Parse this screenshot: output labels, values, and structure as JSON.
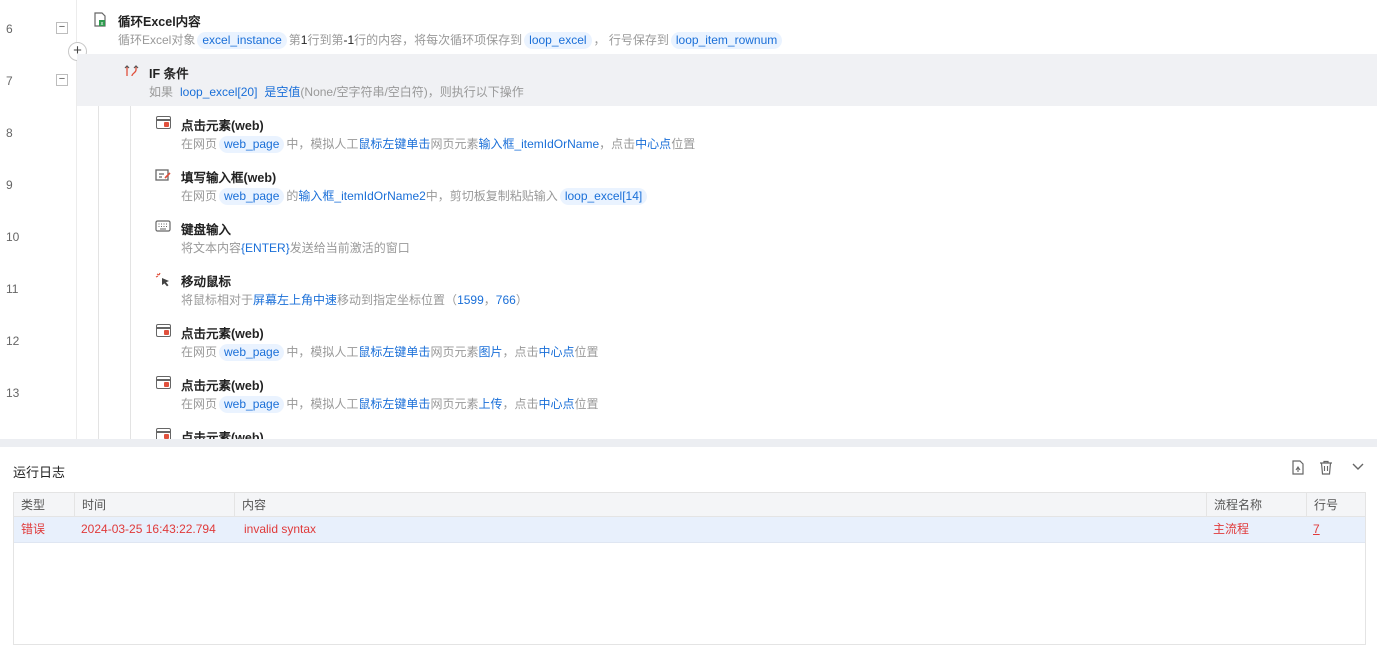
{
  "editor": {
    "line_numbers": [
      "6",
      "7",
      "8",
      "9",
      "10",
      "11",
      "12",
      "13"
    ],
    "loop": {
      "title": "循环Excel内容",
      "d1": "循环Excel对象",
      "var_instance": "excel_instance",
      "d2a": "第",
      "d2b": "1",
      "d2c": "行到第",
      "d2d": "-1",
      "d2e": "行的内容，将每次循环项保存到",
      "var_item": "loop_excel",
      "d3": "，  行号保存到",
      "var_rownum": "loop_item_rownum"
    },
    "if_step": {
      "title": "IF 条件",
      "d1": "如果",
      "var": "loop_excel[20]",
      "kw": "是空值",
      "d2": "(None/空字符串/空白符)，则执行以下操作"
    },
    "click1": {
      "title": "点击元素(web)",
      "d1": "在网页",
      "page": "web_page",
      "d2": "中，模拟人工",
      "kw1": "鼠标左键单击",
      "d3": "网页元素",
      "kw2": "输入框_itemIdOrName",
      "d4": "，点击",
      "kw3": "中心点",
      "d5": "位置"
    },
    "fill": {
      "title": "填写输入框(web)",
      "d1": "在网页",
      "page": "web_page",
      "d2": "的",
      "kw1": "输入框_itemIdOrName2",
      "d3": "中，剪切板复制粘贴输入",
      "var": "loop_excel[14]"
    },
    "keyboard": {
      "title": "键盘输入",
      "d1": "将文本内容",
      "kw1": "{ENTER}",
      "d2": "发送给当前激活的窗口"
    },
    "mouse": {
      "title": "移动鼠标",
      "d1": "将鼠标相对于",
      "kw1": "屏幕左上角",
      "kw2": "中速",
      "d2": "移动到指定坐标位置（",
      "x": "1599",
      "sep": "，",
      "y": "766",
      "d3": "）"
    },
    "click2": {
      "title": "点击元素(web)",
      "d1": "在网页",
      "page": "web_page",
      "d2": "中，模拟人工",
      "kw1": "鼠标左键单击",
      "d3": "网页元素",
      "kw2": "图片",
      "d4": "，点击",
      "kw3": "中心点",
      "d5": "位置"
    },
    "click3": {
      "title": "点击元素(web)",
      "d1": "在网页",
      "page": "web_page",
      "d2": "中，模拟人工",
      "kw1": "鼠标左键单击",
      "d3": "网页元素",
      "kw2": "上传",
      "d4": "，点击",
      "kw3": "中心点",
      "d5": "位置"
    },
    "click4": {
      "title": "点击元素(web)"
    }
  },
  "log": {
    "title": "运行日志",
    "columns": [
      "类型",
      "时间",
      "内容",
      "流程名称",
      "行号"
    ],
    "rows": [
      {
        "type": "错误",
        "time": "2024-03-25 16:43:22.794",
        "content": "invalid syntax",
        "flow": "主流程",
        "line": "7"
      }
    ]
  },
  "colors": {
    "accent": "#1a6fd8",
    "error": "#e03a3a",
    "pill_bg": "#eaf3ff",
    "if_band": "#f0f1f4"
  }
}
